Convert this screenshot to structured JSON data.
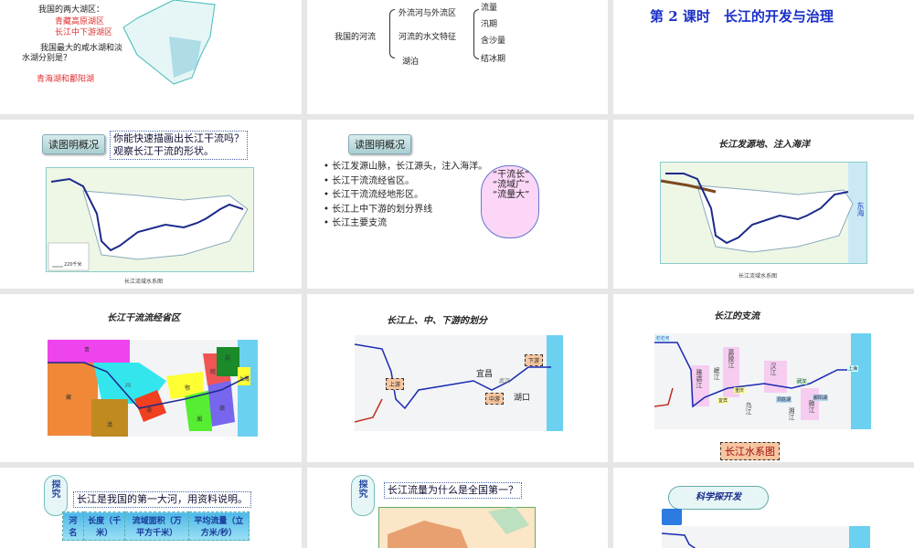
{
  "slide1": {
    "lake_heading": "我国的两大湖区：",
    "lake1": "青藏高原湖区",
    "lake2": "长江中下游湖区",
    "question": "我国最大的咸水湖和淡",
    "question2": "水湖分别是？",
    "answer": "青海湖和鄱阳湖"
  },
  "slide2": {
    "root": "我国的河流",
    "branches": [
      "外流河与外流区",
      "河流的水文特征",
      "湖泊"
    ],
    "features": [
      "流量",
      "汛期",
      "含沙量",
      "结冰期"
    ]
  },
  "slide3": {
    "title": "第 2 课时　长江的开发与治理"
  },
  "slide4": {
    "button": "读图明概况",
    "question1": "你能快速描画出长江干流吗？",
    "question2": "观察长江干流的形状。",
    "caption": "长江流域水系图",
    "legend_scale": "220千米"
  },
  "slide5": {
    "button": "读图明概况",
    "bullets": [
      "长江发源山脉，长江源头，注入海洋。",
      "长江干流流经省区。",
      "长江干流流经地形区。",
      "长江上中下游的划分界线",
      "长江主要支流"
    ],
    "cloud": [
      "“干流长”",
      "“流域广”",
      "“流量大”"
    ]
  },
  "slide6": {
    "title": "长江发源地、注入海洋",
    "caption": "长江流域水系图",
    "sea": "东海"
  },
  "slide7": {
    "title": "长江干流流经省区",
    "labels": [
      "青",
      "藏",
      "川",
      "渝",
      "滇",
      "鄂",
      "湘",
      "赣",
      "皖",
      "苏",
      "上海"
    ]
  },
  "slide8": {
    "title": "长江上、中、下游的划分",
    "labels": [
      "上游",
      "中游",
      "下游",
      "宜昌",
      "湖口",
      "武汉"
    ]
  },
  "slide9": {
    "title": "长江的支流",
    "labels": [
      "沱沱河",
      "雅砻江",
      "岷江",
      "嘉陵江",
      "汉江",
      "乌江",
      "湘江",
      "赣江",
      "洞庭湖",
      "鄱阳湖",
      "重庆",
      "宜宾",
      "武汉",
      "上海"
    ],
    "badge": "长江水系图"
  },
  "slide10": {
    "tag": "探究",
    "prompt": "长江是我国的第一大河，用资料说明。",
    "headers": [
      "河名",
      "长度（千米）",
      "流域面积（万平方千米）",
      "平均流量（立方米/秒）"
    ]
  },
  "slide11": {
    "tag": "探究",
    "prompt": "长江流量为什么是全国第一？"
  },
  "slide12": {
    "cloud": "科学探开发"
  }
}
